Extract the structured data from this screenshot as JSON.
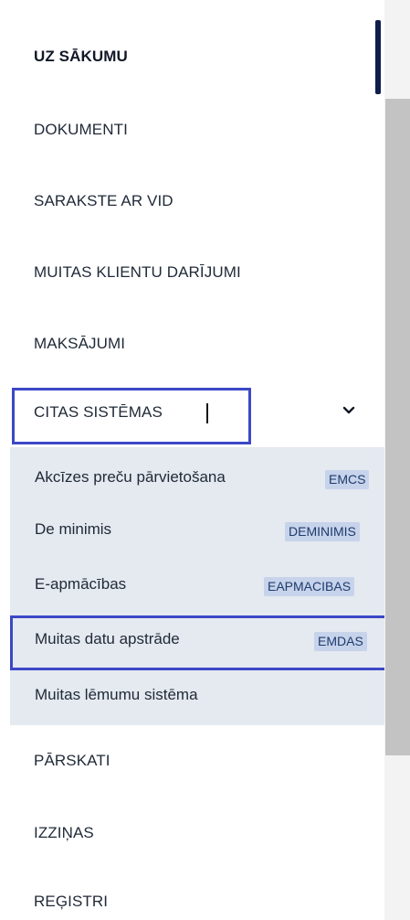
{
  "menu": {
    "items": [
      {
        "label": "UZ SĀKUMU"
      },
      {
        "label": "DOKUMENTI"
      },
      {
        "label": "SARAKSTE AR VID"
      },
      {
        "label": "MUITAS KLIENTU DARĪJUMI"
      },
      {
        "label": "MAKSĀJUMI"
      },
      {
        "label": "CITAS SISTĒMAS"
      },
      {
        "label": "PĀRSKATI"
      },
      {
        "label": "IZZIŅAS"
      },
      {
        "label": "REĢISTRI"
      }
    ],
    "submenu": [
      {
        "label": "Akcīzes preču pārvietošana",
        "badge": "EMCS"
      },
      {
        "label": "De minimis",
        "badge": "DEMINIMIS"
      },
      {
        "label": "E-apmācības",
        "badge": "EAPMACIBAS"
      },
      {
        "label": "Muitas datu apstrāde",
        "badge": "EMDAS"
      },
      {
        "label": "Muitas lēmumu sistēma",
        "badge": ""
      }
    ]
  },
  "colors": {
    "active_bar": "#0f1d4a",
    "highlight_border": "#3b48c7",
    "submenu_bg": "#e5e9f0",
    "badge_bg": "#c6d3ea"
  },
  "icons": {
    "expand": "chevron-down-icon"
  }
}
